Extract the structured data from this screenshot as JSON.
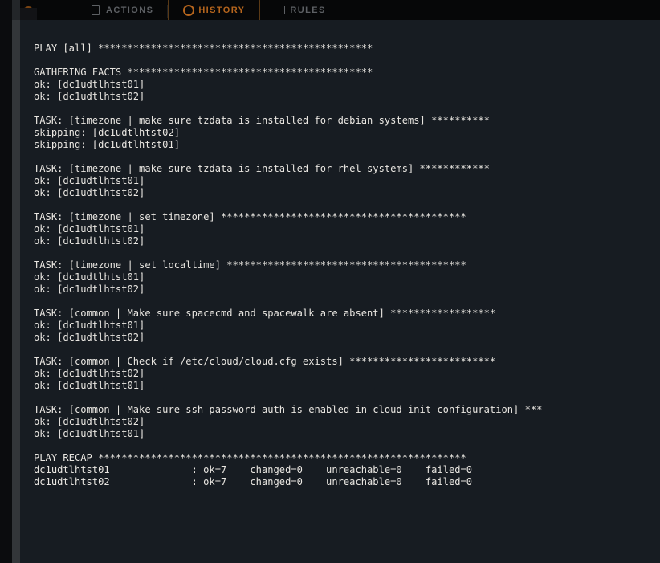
{
  "topbar": {
    "logo_name": "app-logo",
    "tabs": [
      {
        "label": "ACTIONS",
        "icon": "clipboard-icon",
        "active": false
      },
      {
        "label": "HISTORY",
        "icon": "clock-icon",
        "active": true
      },
      {
        "label": "RULES",
        "icon": "document-icon",
        "active": false
      }
    ]
  },
  "colors": {
    "topbar_bg": "#060708",
    "panel_bg": "#171c22",
    "rail_bg": "#0b0c0e",
    "strip_bg": "#333639",
    "strip_marker": "#36220e",
    "text": "#e9e6e1",
    "accent": "#b5651d"
  },
  "console": {
    "title": "ansible-playbook-output",
    "text": "PLAY [all] ***********************************************\n\nGATHERING FACTS ******************************************\nok: [dc1udtlhtst01]\nok: [dc1udtlhtst02]\n\nTASK: [timezone | make sure tzdata is installed for debian systems] **********\nskipping: [dc1udtlhtst02]\nskipping: [dc1udtlhtst01]\n\nTASK: [timezone | make sure tzdata is installed for rhel systems] ************\nok: [dc1udtlhtst01]\nok: [dc1udtlhtst02]\n\nTASK: [timezone | set timezone] ******************************************\nok: [dc1udtlhtst01]\nok: [dc1udtlhtst02]\n\nTASK: [timezone | set localtime] *****************************************\nok: [dc1udtlhtst01]\nok: [dc1udtlhtst02]\n\nTASK: [common | Make sure spacecmd and spacewalk are absent] ******************\nok: [dc1udtlhtst01]\nok: [dc1udtlhtst02]\n\nTASK: [common | Check if /etc/cloud/cloud.cfg exists] *************************\nok: [dc1udtlhtst02]\nok: [dc1udtlhtst01]\n\nTASK: [common | Make sure ssh password auth is enabled in cloud init configuration] ***\nok: [dc1udtlhtst02]\nok: [dc1udtlhtst01]\n\nPLAY RECAP ***************************************************************\ndc1udtlhtst01              : ok=7    changed=0    unreachable=0    failed=0\ndc1udtlhtst02              : ok=7    changed=0    unreachable=0    failed=0",
    "play": "PLAY [all]",
    "gathering_facts": "GATHERING FACTS",
    "hosts": [
      "dc1udtlhtst01",
      "dc1udtlhtst02"
    ],
    "tasks": [
      {
        "name": "timezone | make sure tzdata is installed for debian systems",
        "results": [
          "skipping: [dc1udtlhtst02]",
          "skipping: [dc1udtlhtst01]"
        ]
      },
      {
        "name": "timezone | make sure tzdata is installed for rhel systems",
        "results": [
          "ok: [dc1udtlhtst01]",
          "ok: [dc1udtlhtst02]"
        ]
      },
      {
        "name": "timezone | set timezone",
        "results": [
          "ok: [dc1udtlhtst01]",
          "ok: [dc1udtlhtst02]"
        ]
      },
      {
        "name": "timezone | set localtime",
        "results": [
          "ok: [dc1udtlhtst01]",
          "ok: [dc1udtlhtst02]"
        ]
      },
      {
        "name": "common | Make sure spacecmd and spacewalk are absent",
        "results": [
          "ok: [dc1udtlhtst01]",
          "ok: [dc1udtlhtst02]"
        ]
      },
      {
        "name": "common | Check if /etc/cloud/cloud.cfg exists",
        "results": [
          "ok: [dc1udtlhtst02]",
          "ok: [dc1udtlhtst01]"
        ]
      },
      {
        "name": "common | Make sure ssh password auth is enabled in cloud init configuration",
        "results": [
          "ok: [dc1udtlhtst02]",
          "ok: [dc1udtlhtst01]"
        ]
      }
    ],
    "recap_header": "PLAY RECAP",
    "recap": [
      {
        "host": "dc1udtlhtst01",
        "ok": "ok=7",
        "changed": "changed=0",
        "unreachable": "unreachable=0",
        "failed": "failed=0"
      },
      {
        "host": "dc1udtlhtst02",
        "ok": "ok=7",
        "changed": "changed=0",
        "unreachable": "unreachable=0",
        "failed": "failed=0"
      }
    ]
  }
}
